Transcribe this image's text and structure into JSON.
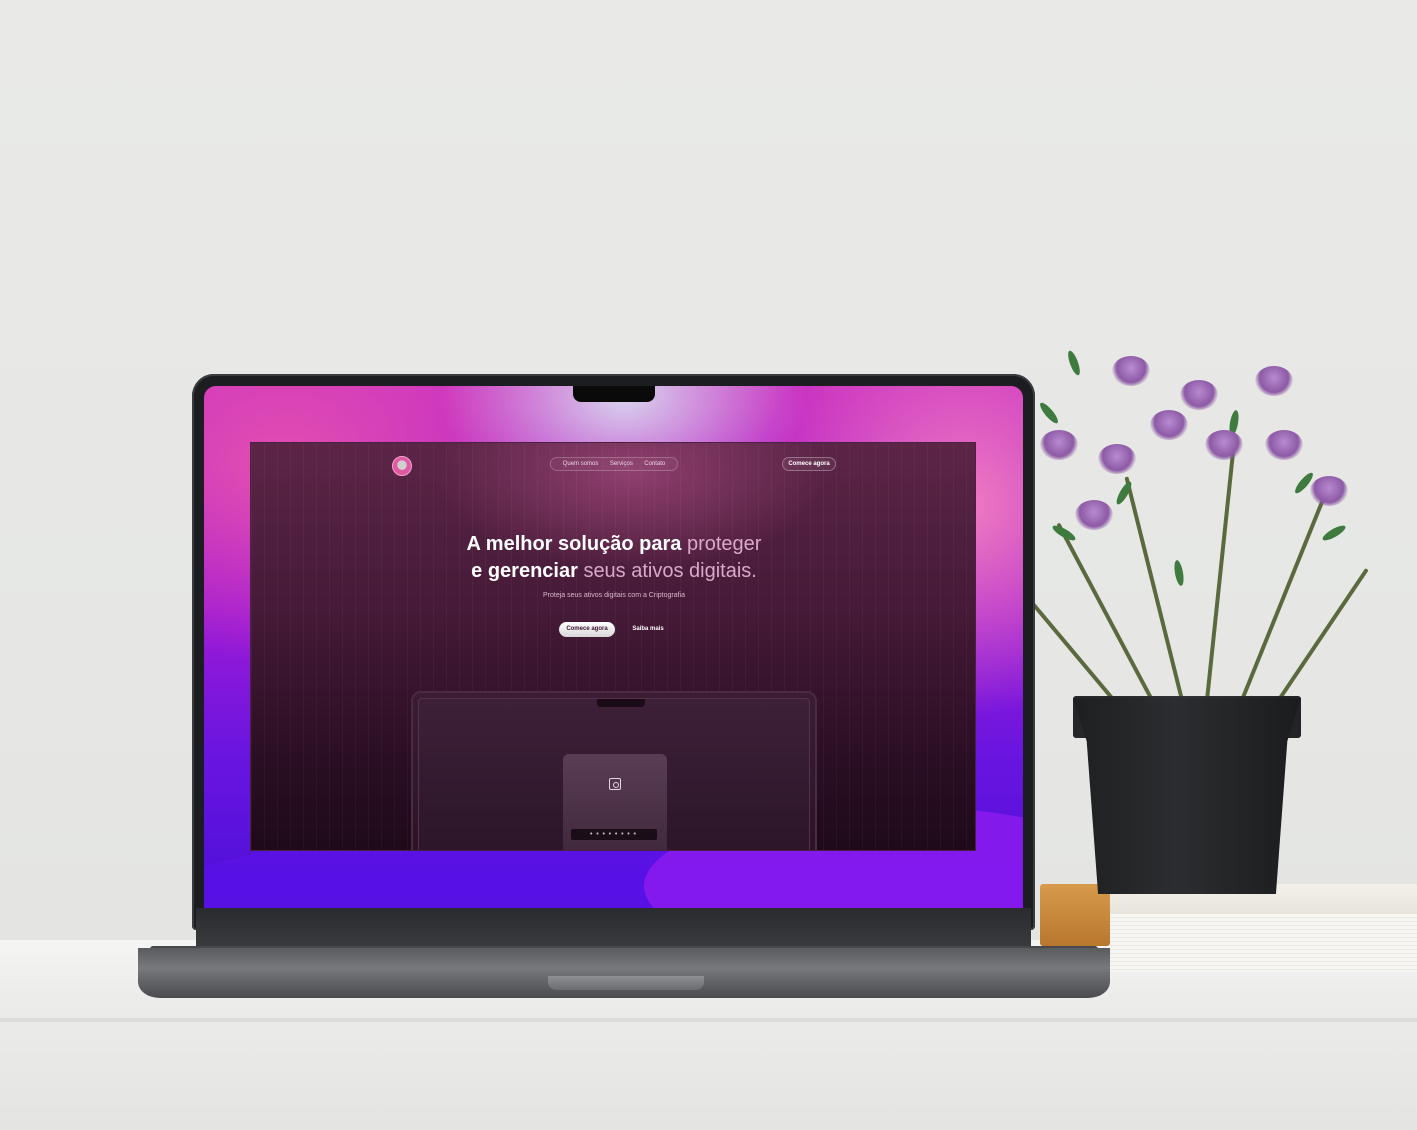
{
  "site": {
    "nav": {
      "items": [
        "Quem somos",
        "Serviços",
        "Contato"
      ],
      "cta": "Comece agora"
    },
    "hero": {
      "title_part1": "A melhor solução para ",
      "title_part1_dim": "proteger",
      "title_part2": "e gerenciar ",
      "title_part2_dim": "seus ativos digitais.",
      "subtitle": "Proteja seus ativos digitais com a Criptografia",
      "primary_button": "Comece agora",
      "secondary_button": "Saiba mais"
    },
    "preview": {
      "pin_mask": "••••••••"
    }
  },
  "colors": {
    "accent": "#e05aa3",
    "background": "#461a38"
  },
  "icons": [
    "logo-avatar-icon",
    "face-scan-icon"
  ]
}
